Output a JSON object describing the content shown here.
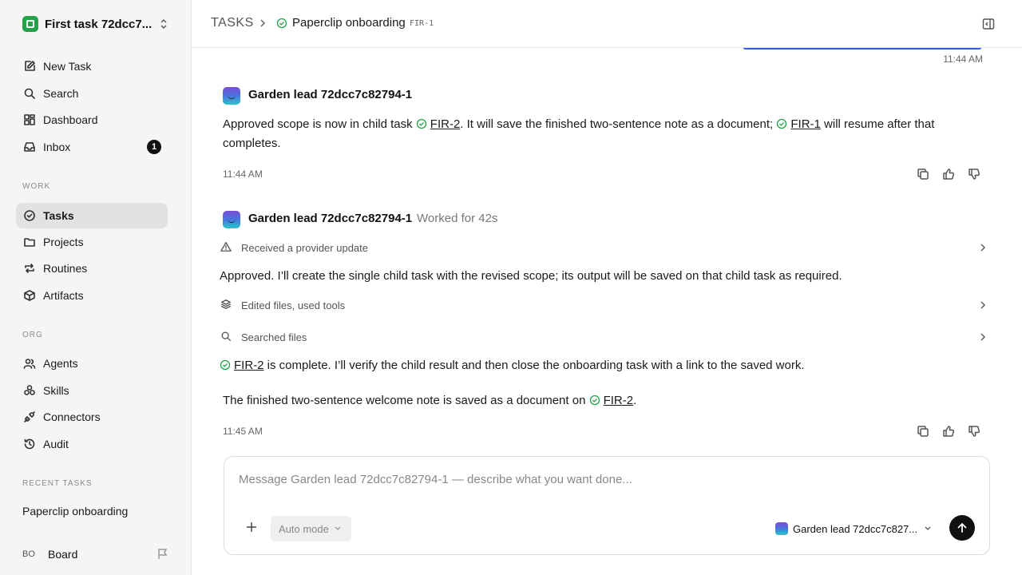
{
  "sidebar": {
    "workspace_name": "First task 72dcc7...",
    "nav_top": [
      {
        "label": "New Task",
        "icon": "edit-icon"
      },
      {
        "label": "Search",
        "icon": "search-icon"
      },
      {
        "label": "Dashboard",
        "icon": "dashboard-icon"
      },
      {
        "label": "Inbox",
        "icon": "inbox-icon",
        "badge": "1"
      }
    ],
    "section_work": "WORK",
    "nav_work": [
      {
        "label": "Tasks",
        "icon": "check-circle-icon",
        "active": true
      },
      {
        "label": "Projects",
        "icon": "folder-icon"
      },
      {
        "label": "Routines",
        "icon": "repeat-icon"
      },
      {
        "label": "Artifacts",
        "icon": "box-icon"
      }
    ],
    "section_org": "ORG",
    "nav_org": [
      {
        "label": "Agents",
        "icon": "users-icon"
      },
      {
        "label": "Skills",
        "icon": "skills-icon"
      },
      {
        "label": "Connectors",
        "icon": "plug-icon"
      },
      {
        "label": "Audit",
        "icon": "history-icon"
      }
    ],
    "section_recent": "RECENT TASKS",
    "recent_task": "Paperclip onboarding",
    "board_initials": "BO",
    "board_label": "Board"
  },
  "header": {
    "root": "TASKS",
    "title": "Paperclip onboarding",
    "task_id": "FIR-1"
  },
  "thread": {
    "top_time": "11:44 AM",
    "msg1": {
      "author": "Garden lead 72dcc7c82794-1",
      "text_a": "Approved scope is now in child task ",
      "link_a": "FIR-2",
      "text_b": ". It will save the finished two-sentence note as a document; ",
      "link_b": "FIR-1",
      "text_c": " will resume after that completes.",
      "time": "11:44 AM"
    },
    "msg2": {
      "author": "Garden lead 72dcc7c82794-1",
      "worked": "Worked for 42s",
      "tool1": "Received a provider update",
      "text1": "Approved. I’ll create the single child task with the revised scope; its output will be saved on that child task as required.",
      "tool2": "Edited files, used tools",
      "tool3": "Searched files",
      "link2": "FIR-2",
      "text2": " is complete. I’ll verify the child result and then close the onboarding task with a link to the saved work.",
      "text3a": "The finished two-sentence welcome note is saved as a document on ",
      "link3": "FIR-2",
      "text3b": ".",
      "time": "11:45 AM"
    }
  },
  "composer": {
    "placeholder": "Message Garden lead 72dcc7c82794-1 — describe what you want done...",
    "mode": "Auto mode",
    "agent": "Garden lead 72dcc7c827..."
  },
  "colors": {
    "accent_blue": "#2b63d6",
    "success_green": "#22a34a",
    "active_bg": "#e2e2e2"
  }
}
